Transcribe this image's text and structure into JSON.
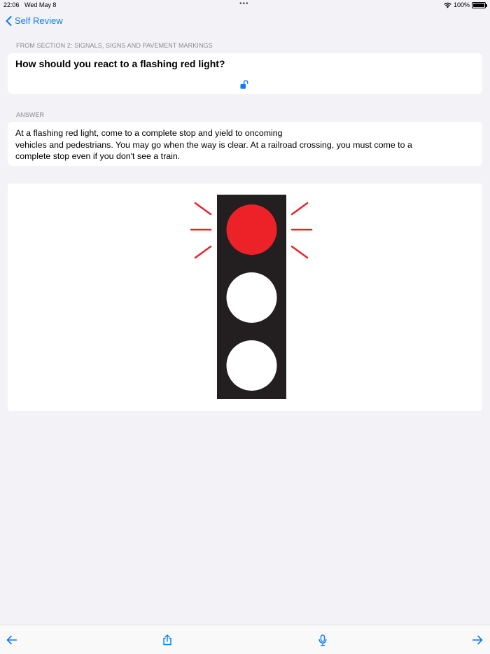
{
  "status_bar": {
    "time": "22:06",
    "date": "Wed May 8",
    "dots": "•••",
    "battery": "100%"
  },
  "nav": {
    "back_label": "Self Review"
  },
  "question": {
    "section_label": "FROM SECTION 2: SIGNALS, SIGNS AND PAVEMENT MARKINGS",
    "text": "How should you react to a flashing red light?"
  },
  "answer": {
    "section_label": "ANSWER",
    "lines": [
      "At a flashing red light, come to a complete stop and yield to oncoming",
      "vehicles and pedestrians. You may go when the way is clear. At a railroad crossing, you must come to a",
      "complete stop even if you don't see a train."
    ]
  },
  "image": {
    "subject": "traffic-light-flashing-red"
  },
  "colors": {
    "accent": "#0a7aff",
    "red_light": "#ed2228",
    "housing": "#231f20",
    "background": "#f2f2f7"
  },
  "icons": {
    "back": "chevron-left-icon",
    "lock": "unlocked-lock-icon",
    "prev": "arrow-left-icon",
    "share": "share-icon",
    "mic": "microphone-icon",
    "next": "arrow-right-icon"
  }
}
